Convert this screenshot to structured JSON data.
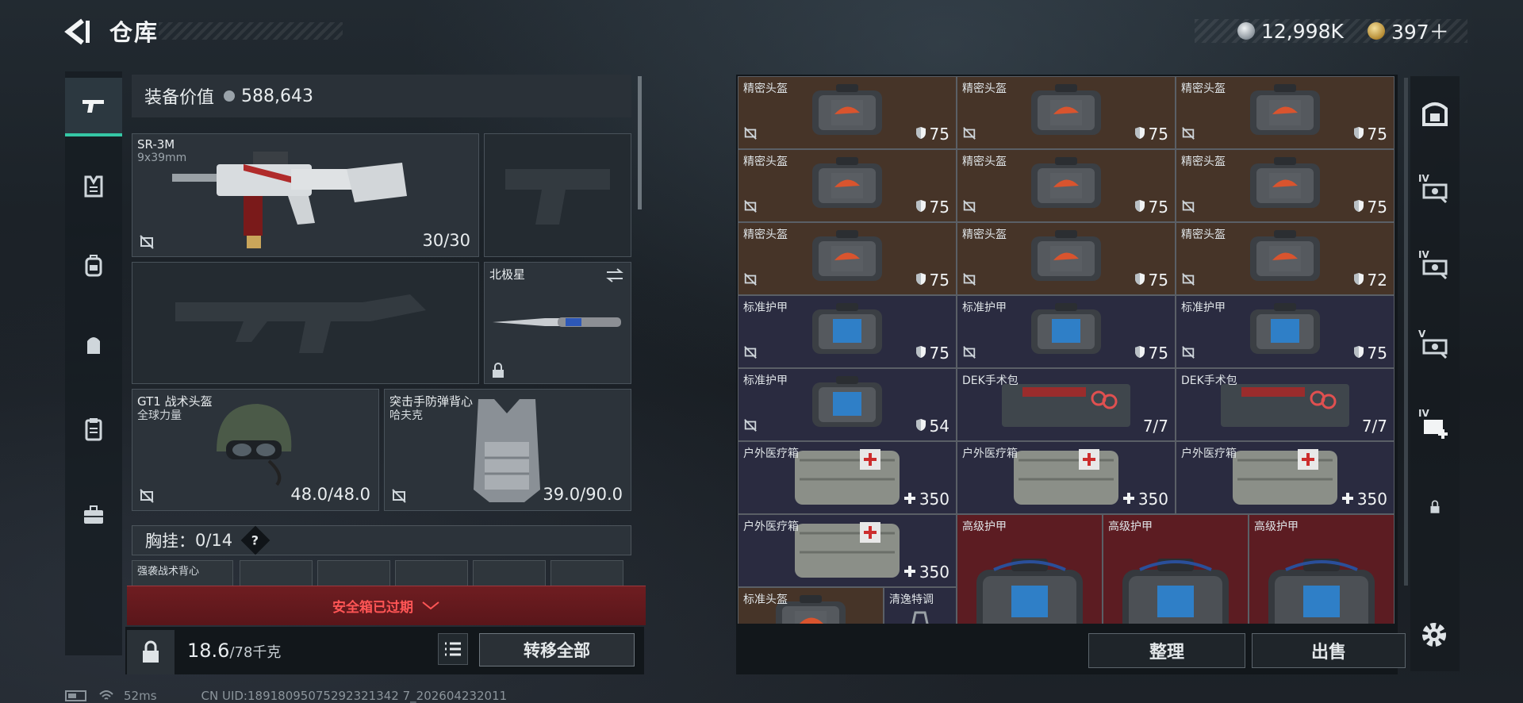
{
  "header": {
    "title": "仓库",
    "currency_silver": "12,998K",
    "currency_gold": "397＋"
  },
  "equipment": {
    "value_label": "装备价值",
    "value": "588,643",
    "primary_weapon": {
      "name": "SR-3M",
      "caliber": "9x39mm",
      "ammo": "30/30"
    },
    "melee": {
      "name": "北极星"
    },
    "helmet": {
      "name": "GT1 战术头盔",
      "sub": "全球力量",
      "durability": "48.0/48.0"
    },
    "armor": {
      "name": "突击手防弹背心",
      "sub": "哈夫克",
      "durability": "39.0/90.0"
    },
    "chest_rig": {
      "label": "胸挂：",
      "capacity": "0/14",
      "help": "?"
    },
    "vest_item": {
      "name": "强袭战术背心"
    },
    "safe_box_status": "安全箱已过期",
    "weight": "18.6",
    "weight_max": "/78千克",
    "transfer_all": "转移全部"
  },
  "storage": {
    "items": [
      {
        "name": "精密头盔",
        "value": "75",
        "type": "helmet"
      },
      {
        "name": "精密头盔",
        "value": "75",
        "type": "helmet"
      },
      {
        "name": "精密头盔",
        "value": "75",
        "type": "helmet"
      },
      {
        "name": "精密头盔",
        "value": "75",
        "type": "helmet"
      },
      {
        "name": "精密头盔",
        "value": "75",
        "type": "helmet"
      },
      {
        "name": "精密头盔",
        "value": "75",
        "type": "helmet"
      },
      {
        "name": "精密头盔",
        "value": "75",
        "type": "helmet"
      },
      {
        "name": "精密头盔",
        "value": "75",
        "type": "helmet"
      },
      {
        "name": "精密头盔",
        "value": "72",
        "type": "helmet"
      },
      {
        "name": "标准护甲",
        "value": "75",
        "type": "armor"
      },
      {
        "name": "标准护甲",
        "value": "75",
        "type": "armor"
      },
      {
        "name": "标准护甲",
        "value": "75",
        "type": "armor"
      },
      {
        "name": "标准护甲",
        "value": "54",
        "type": "armor"
      },
      {
        "name": "DEK手术包",
        "value": "7/7",
        "type": "kit"
      },
      {
        "name": "DEK手术包",
        "value": "7/7",
        "type": "kit"
      },
      {
        "name": "户外医疗箱",
        "value": "350",
        "type": "med"
      },
      {
        "name": "户外医疗箱",
        "value": "350",
        "type": "med"
      },
      {
        "name": "户外医疗箱",
        "value": "350",
        "type": "med"
      },
      {
        "name": "户外医疗箱",
        "value": "350",
        "type": "med"
      },
      {
        "name": "高级护甲",
        "value": "",
        "type": "adv"
      },
      {
        "name": "高级护甲",
        "value": "",
        "type": "adv"
      },
      {
        "name": "高级护甲",
        "value": "",
        "type": "adv"
      },
      {
        "name": "标准头盔",
        "value": "",
        "type": "helmet"
      },
      {
        "name": "清逸特调",
        "value": "",
        "type": "misc"
      }
    ],
    "sort_label": "整理",
    "sell_label": "出售"
  },
  "right_nav": {
    "tag_1": "IV",
    "tag_2": "IV",
    "tag_3": "V",
    "tag_4": "IV"
  },
  "status_bar": {
    "ping": "52ms",
    "uid": "CN UID:18918095075292321342 7_202604232011"
  },
  "colors": {
    "accent": "#35c7a5",
    "helmet_cell": "#463428",
    "armor_cell": "#2a2b40",
    "adv_cell": "#5c1c22",
    "expired_red": "#ff5555"
  }
}
